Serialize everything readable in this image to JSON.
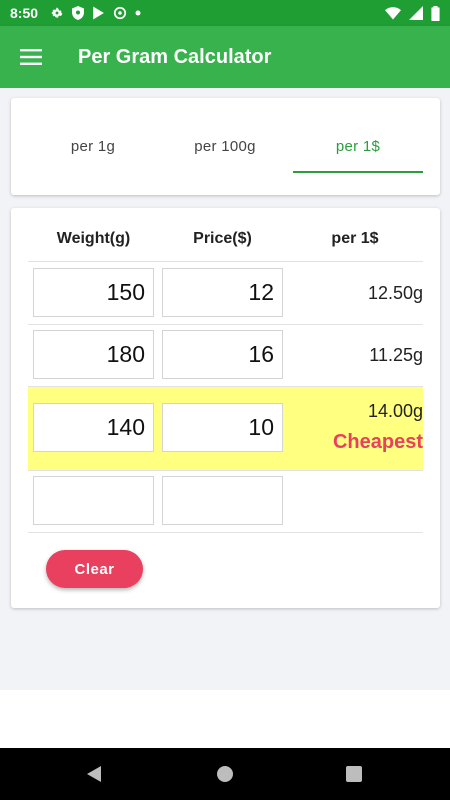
{
  "status_bar": {
    "time": "8:50",
    "icons": [
      "settings-icon",
      "shield-icon",
      "play-store-icon",
      "at-sign-icon",
      "dot-icon"
    ],
    "right_icons": [
      "wifi-icon",
      "signal-icon",
      "battery-icon"
    ]
  },
  "app_bar": {
    "title": "Per Gram Calculator",
    "menu_icon": "hamburger-menu-icon",
    "color": "#37b24d"
  },
  "tabs": [
    {
      "label": "per 1g",
      "active": false
    },
    {
      "label": "per 100g",
      "active": false
    },
    {
      "label": "per 1$",
      "active": true
    }
  ],
  "table": {
    "headers": {
      "weight": "Weight(g)",
      "price": "Price($)",
      "result": "per 1$"
    },
    "rows": [
      {
        "weight": "150",
        "price": "12",
        "result": "12.50g",
        "cheapest": false
      },
      {
        "weight": "180",
        "price": "16",
        "result": "11.25g",
        "cheapest": false
      },
      {
        "weight": "140",
        "price": "10",
        "result": "14.00g",
        "cheapest": true,
        "cheapest_label": "Cheapest"
      },
      {
        "weight": "",
        "price": "",
        "result": "",
        "cheapest": false
      }
    ]
  },
  "clear_button": {
    "label": "Clear"
  },
  "colors": {
    "accent": "#2a9d3c",
    "highlight": "#ffff80",
    "cheapest": "#e8405e",
    "button": "#e8405e"
  }
}
